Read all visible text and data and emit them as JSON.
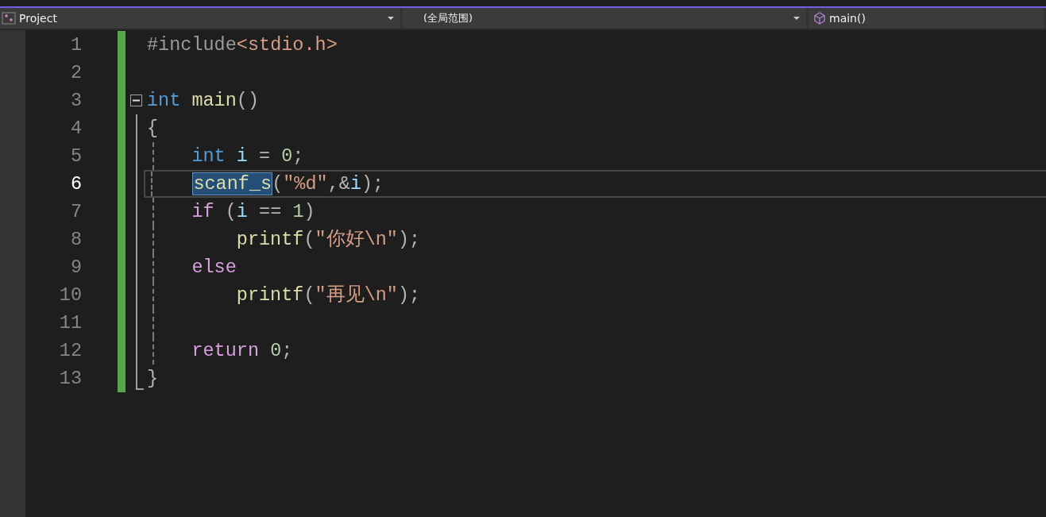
{
  "navigation_bar": [
    {
      "kind": "project",
      "label": "Project"
    },
    {
      "kind": "scope",
      "label": "(全局范围)"
    },
    {
      "kind": "member",
      "label": "main()"
    }
  ],
  "editor": {
    "lines": [
      {
        "number": "1",
        "current": false,
        "changed": true,
        "tokens": [
          {
            "text": "#include",
            "kind": "preprocessor",
            "selected": false
          },
          {
            "text": "<stdio.h>",
            "kind": "string",
            "selected": false
          }
        ]
      },
      {
        "number": "2",
        "current": false,
        "changed": true
      },
      {
        "number": "3",
        "current": false,
        "changed": true,
        "fold": {
          "expanded": true
        },
        "tokens": [
          {
            "text": "int",
            "kind": "keyword",
            "selected": false
          },
          {
            "text": " main",
            "kind": "function",
            "selected": false
          },
          {
            "text": "()",
            "kind": "punctuation",
            "selected": false
          }
        ]
      },
      {
        "number": "4",
        "current": false,
        "changed": true,
        "tokens": [
          {
            "text": "{",
            "kind": "punctuation",
            "selected": false
          }
        ],
        "children": [
          {
            "number": "5",
            "current": false,
            "changed": true,
            "tokens": [
              {
                "text": "int",
                "kind": "keyword",
                "selected": false
              },
              {
                "text": " i",
                "kind": "variable",
                "selected": false
              },
              {
                "text": " = ",
                "kind": "punctuation",
                "selected": false
              },
              {
                "text": "0",
                "kind": "number",
                "selected": false
              },
              {
                "text": ";",
                "kind": "punctuation",
                "selected": false
              }
            ]
          },
          {
            "number": "6",
            "current": true,
            "changed": true,
            "tokens": [
              {
                "text": "scanf_s",
                "kind": "function",
                "selected": true
              },
              {
                "text": "(",
                "kind": "punctuation",
                "selected": false
              },
              {
                "text": "\"%d\"",
                "kind": "string",
                "selected": false
              },
              {
                "text": ",&",
                "kind": "punctuation",
                "selected": false
              },
              {
                "text": "i",
                "kind": "variable",
                "selected": false
              },
              {
                "text": ");",
                "kind": "punctuation",
                "selected": false
              }
            ]
          },
          {
            "number": "7",
            "current": false,
            "changed": true,
            "tokens": [
              {
                "text": "if",
                "kind": "control",
                "selected": false
              },
              {
                "text": " (",
                "kind": "punctuation",
                "selected": false
              },
              {
                "text": "i",
                "kind": "variable",
                "selected": false
              },
              {
                "text": " == ",
                "kind": "punctuation",
                "selected": false
              },
              {
                "text": "1",
                "kind": "number",
                "selected": false
              },
              {
                "text": ")",
                "kind": "punctuation",
                "selected": false
              }
            ],
            "children": [
              {
                "number": "8",
                "current": false,
                "changed": true,
                "tokens": [
                  {
                    "text": "printf",
                    "kind": "function",
                    "selected": false
                  },
                  {
                    "text": "(",
                    "kind": "punctuation",
                    "selected": false
                  },
                  {
                    "text": "\"你好\\n\"",
                    "kind": "string",
                    "selected": false
                  },
                  {
                    "text": ");",
                    "kind": "punctuation",
                    "selected": false
                  }
                ]
              }
            ]
          },
          {
            "number": "9",
            "current": false,
            "changed": true,
            "tokens": [
              {
                "text": "else",
                "kind": "control",
                "selected": false
              }
            ],
            "children": [
              {
                "number": "10",
                "current": false,
                "changed": true,
                "tokens": [
                  {
                    "text": "printf",
                    "kind": "function",
                    "selected": false
                  },
                  {
                    "text": "(",
                    "kind": "punctuation",
                    "selected": false
                  },
                  {
                    "text": "\"再见\\n\"",
                    "kind": "string",
                    "selected": false
                  },
                  {
                    "text": ");",
                    "kind": "punctuation",
                    "selected": false
                  }
                ]
              }
            ]
          },
          {
            "number": "11",
            "current": false,
            "changed": true
          },
          {
            "number": "12",
            "current": false,
            "changed": true,
            "tokens": [
              {
                "text": "return",
                "kind": "control",
                "selected": false
              },
              {
                "text": " 0",
                "kind": "number",
                "selected": false
              },
              {
                "text": ";",
                "kind": "punctuation",
                "selected": false
              }
            ]
          }
        ]
      },
      {
        "number": "13",
        "current": false,
        "changed": true,
        "tokens": [
          {
            "text": "}",
            "kind": "punctuation",
            "selected": false
          }
        ]
      }
    ]
  }
}
